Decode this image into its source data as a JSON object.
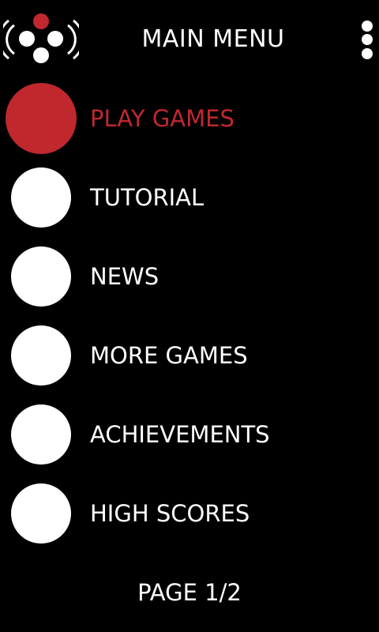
{
  "header": {
    "title": "MAIN MENU",
    "logo_icon": "gamepad-broadcast-icon",
    "menu_icon": "overflow-menu-icon"
  },
  "colors": {
    "background": "#000000",
    "text": "#ffffff",
    "accent": "#c0282e"
  },
  "menu": {
    "items": [
      {
        "label": "PLAY GAMES",
        "icon": "circle-icon",
        "active": true
      },
      {
        "label": "TUTORIAL",
        "icon": "circle-icon",
        "active": false
      },
      {
        "label": "NEWS",
        "icon": "circle-icon",
        "active": false
      },
      {
        "label": "MORE GAMES",
        "icon": "circle-icon",
        "active": false
      },
      {
        "label": "ACHIEVEMENTS",
        "icon": "circle-icon",
        "active": false
      },
      {
        "label": "HIGH SCORES",
        "icon": "circle-icon",
        "active": false
      }
    ]
  },
  "footer": {
    "page_indicator": "PAGE 1/2"
  }
}
